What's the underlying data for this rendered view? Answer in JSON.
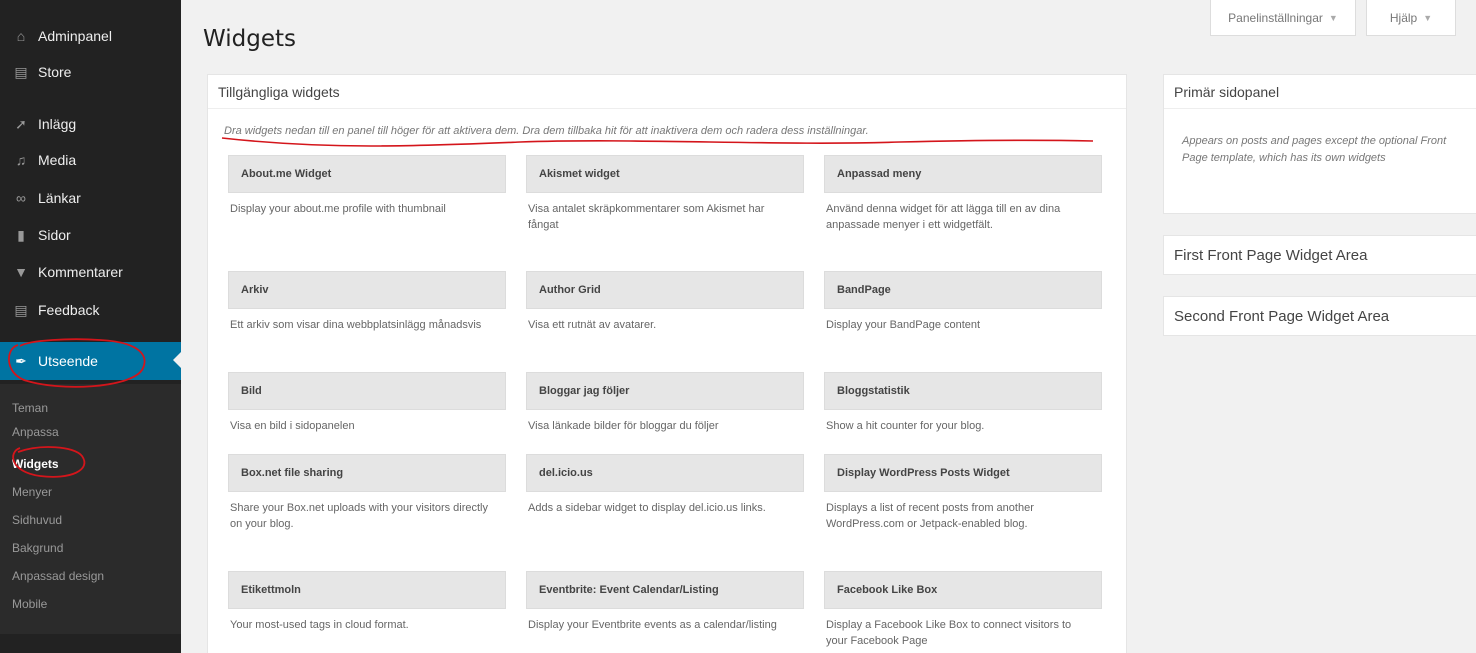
{
  "sidebar": {
    "items": [
      {
        "label": "Adminpanel",
        "icon": "home-icon"
      },
      {
        "label": "Store",
        "icon": "cart-icon"
      },
      {
        "label": "Inlägg",
        "icon": "pin-icon"
      },
      {
        "label": "Media",
        "icon": "media-icon"
      },
      {
        "label": "Länkar",
        "icon": "link-icon"
      },
      {
        "label": "Sidor",
        "icon": "page-icon"
      },
      {
        "label": "Kommentarer",
        "icon": "comment-icon"
      },
      {
        "label": "Feedback",
        "icon": "feedback-icon"
      },
      {
        "label": "Utseende",
        "icon": "brush-icon"
      }
    ],
    "submenu": [
      "Teman",
      "Anpassa",
      "Widgets",
      "Menyer",
      "Sidhuvud",
      "Bakgrund",
      "Anpassad design",
      "Mobile"
    ],
    "current_submenu": "Widgets",
    "accent_color": "#0074a2"
  },
  "header": {
    "title": "Widgets",
    "screen_options": "Panelinställningar",
    "help": "Hjälp"
  },
  "available": {
    "title": "Tillgängliga widgets",
    "description": "Dra widgets nedan till en panel till höger för att aktivera dem. Dra dem tillbaka hit för att inaktivera dem och radera dess inställningar.",
    "widgets": [
      {
        "title": "About.me Widget",
        "desc": "Display your about.me profile with thumbnail"
      },
      {
        "title": "Akismet widget",
        "desc": "Visa antalet skräpkommentarer som Akismet har fångat"
      },
      {
        "title": "Anpassad meny",
        "desc": "Använd denna widget för att lägga till en av dina anpassade menyer i ett widgetfält."
      },
      {
        "title": "Arkiv",
        "desc": "Ett arkiv som visar dina webbplatsinlägg månadsvis"
      },
      {
        "title": "Author Grid",
        "desc": "Visa ett rutnät av avatarer."
      },
      {
        "title": "BandPage",
        "desc": "Display your BandPage content"
      },
      {
        "title": "Bild",
        "desc": "Visa en bild i sidopanelen"
      },
      {
        "title": "Bloggar jag följer",
        "desc": "Visa länkade bilder för bloggar du följer"
      },
      {
        "title": "Bloggstatistik",
        "desc": "Show a hit counter for your blog."
      },
      {
        "title": "Box.net file sharing",
        "desc": "Share your Box.net uploads with your visitors directly on your blog."
      },
      {
        "title": "del.icio.us",
        "desc": "Adds a sidebar widget to display del.icio.us links."
      },
      {
        "title": "Display WordPress Posts Widget",
        "desc": "Displays a list of recent posts from another WordPress.com or Jetpack-enabled blog."
      },
      {
        "title": "Etikettmoln",
        "desc": "Your most-used tags in cloud format."
      },
      {
        "title": "Eventbrite: Event Calendar/Listing",
        "desc": "Display your Eventbrite events as a calendar/listing"
      },
      {
        "title": "Facebook Like Box",
        "desc": "Display a Facebook Like Box to connect visitors to your Facebook Page"
      }
    ]
  },
  "sidebars": {
    "primary_title": "Primär sidopanel",
    "primary_desc": "Appears on posts and pages except the optional Front Page template, which has its own widgets",
    "front1": "First Front Page Widget Area",
    "front2": "Second Front Page Widget Area"
  }
}
